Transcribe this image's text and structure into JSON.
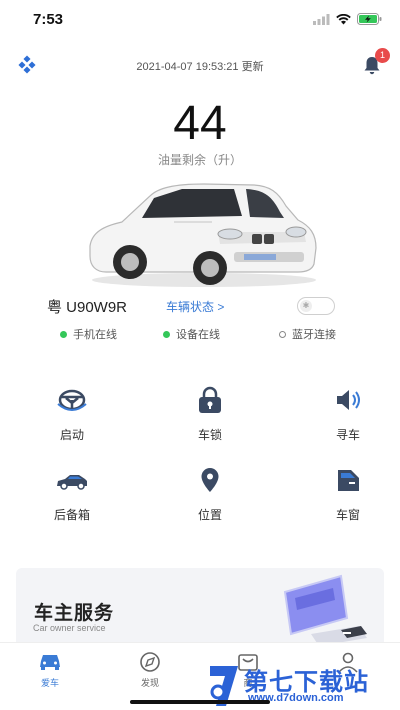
{
  "status_bar": {
    "time": "7:53"
  },
  "header": {
    "update_text": "2021-04-07 19:53:21 更新",
    "notification_count": "1"
  },
  "fuel": {
    "value": "44",
    "label": "油量剩余（升）"
  },
  "vehicle": {
    "plate": "粤 U90W9R",
    "status_link": "车辆状态 >",
    "toggle_icon": "bluetooth-icon"
  },
  "connections": [
    {
      "label": "手机在线",
      "state": "online"
    },
    {
      "label": "设备在线",
      "state": "online"
    },
    {
      "label": "蓝牙连接",
      "state": "offline"
    }
  ],
  "controls": [
    {
      "label": "启动",
      "icon": "steering-wheel-icon"
    },
    {
      "label": "车锁",
      "icon": "lock-icon"
    },
    {
      "label": "寻车",
      "icon": "speaker-icon"
    },
    {
      "label": "后备箱",
      "icon": "car-side-icon"
    },
    {
      "label": "位置",
      "icon": "location-pin-icon"
    },
    {
      "label": "车窗",
      "icon": "car-window-icon"
    }
  ],
  "service_card": {
    "title": "车主服务",
    "subtitle": "Car owner service"
  },
  "tabs": [
    {
      "label": "爱车",
      "icon": "car-icon",
      "active": true
    },
    {
      "label": "发现",
      "icon": "compass-icon",
      "active": false
    },
    {
      "label": "商",
      "icon": "shop-icon",
      "active": false
    },
    {
      "label": "",
      "icon": "profile-icon",
      "active": false
    }
  ],
  "watermark": {
    "main": "第七下载站",
    "sub": "www.d7down.com"
  },
  "colors": {
    "accent": "#3a7bd5",
    "icon_dark": "#3b4a63",
    "online": "#34c759",
    "badge": "#e84b4b"
  }
}
